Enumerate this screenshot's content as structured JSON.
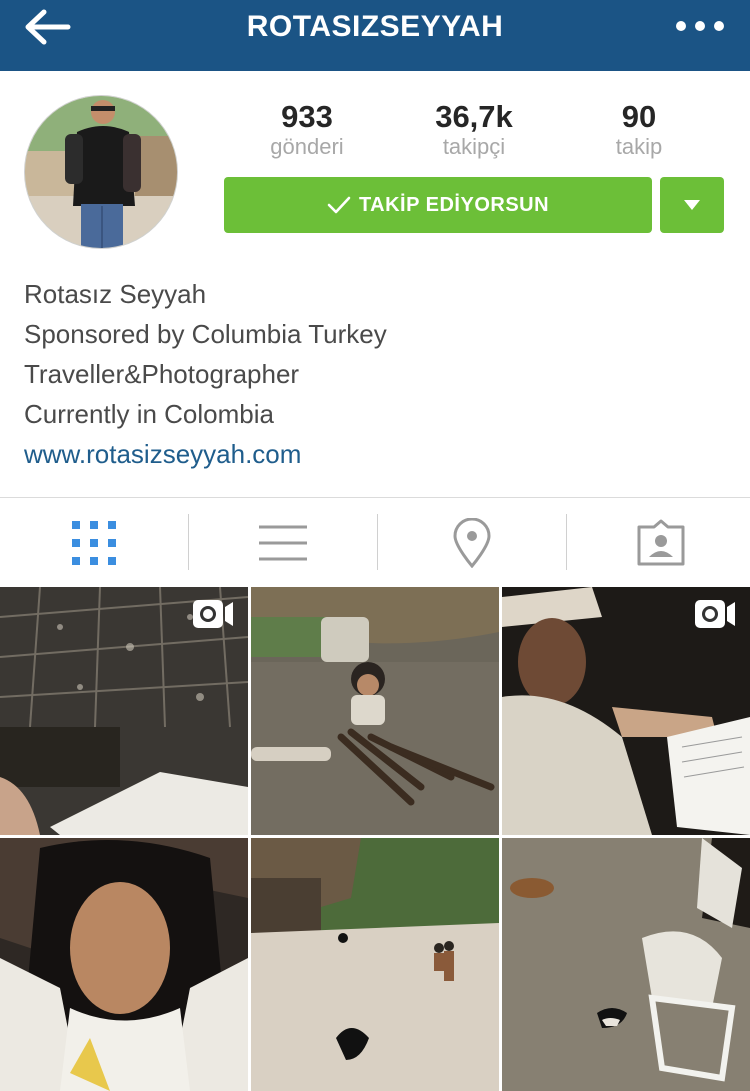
{
  "header": {
    "title": "ROTASIZSEYYAH",
    "colors": {
      "bar": "#1b5485",
      "text": "#ffffff"
    },
    "back_icon": "arrow-left-icon",
    "more_icon": "more-dots-icon"
  },
  "profile": {
    "stats": [
      {
        "value": "933",
        "label": "gönderi"
      },
      {
        "value": "36,7k",
        "label": "takipçi"
      },
      {
        "value": "90",
        "label": "takip"
      }
    ],
    "follow_button": {
      "label": "TAKİP EDİYORSUN",
      "color": "#6cbf38"
    }
  },
  "bio": {
    "name": "Rotasız Seyyah",
    "lines": [
      "Sponsored by Columbia Turkey",
      "Traveller&Photographer",
      "Currently in Colombia"
    ],
    "link": "www.rotasizseyyah.com"
  },
  "tabs": [
    {
      "icon": "grid-icon",
      "active": true
    },
    {
      "icon": "list-icon",
      "active": false
    },
    {
      "icon": "location-pin-icon",
      "active": false
    },
    {
      "icon": "tagged-photos-icon",
      "active": false
    }
  ],
  "posts": [
    {
      "subject": "thatched hut interior with book",
      "video": true
    },
    {
      "subject": "girl with firewood",
      "video": false
    },
    {
      "subject": "elder reading document",
      "video": true
    },
    {
      "subject": "smiling girl portrait",
      "video": false
    },
    {
      "subject": "village children and chickens",
      "video": false
    },
    {
      "subject": "man sitting on chair with cat",
      "video": false
    }
  ]
}
